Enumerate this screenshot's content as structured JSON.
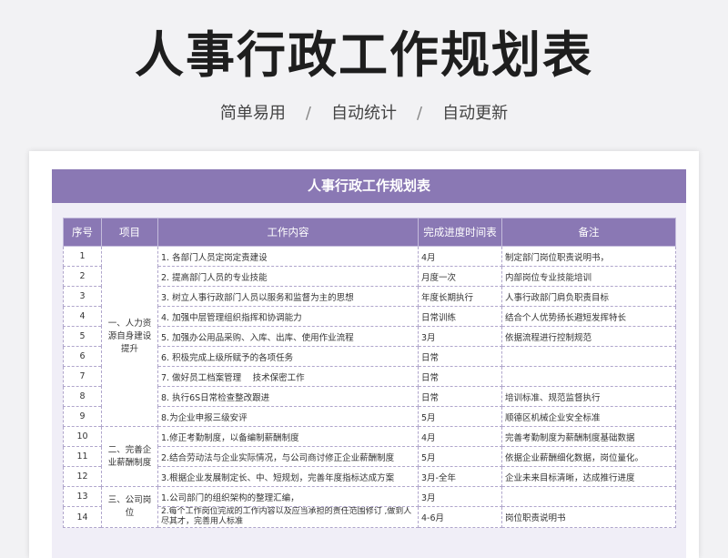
{
  "page": {
    "title": "人事行政工作规划表",
    "subtitle": [
      "简单易用",
      "自动统计",
      "自动更新"
    ],
    "separator": "/"
  },
  "sheet": {
    "header_title": "人事行政工作规划表",
    "columns": [
      "序号",
      "项目",
      "工作内容",
      "完成进度时间表",
      "备注"
    ],
    "rows": [
      {
        "no": "1",
        "content": "1. 各部门人员定岗定责建设",
        "time": "4月",
        "note": "制定部门岗位职责说明书，"
      },
      {
        "no": "2",
        "content": "2. 提高部门人员的专业技能",
        "time": "月度一次",
        "note": "内部岗位专业技能培训"
      },
      {
        "no": "3",
        "content": "3. 树立人事行政部门人员以服务和监督为主的思想",
        "time": "年度长期执行",
        "note": "人事行政部门肩负职责目标"
      },
      {
        "no": "4",
        "content": "4. 加强中层管理组织指挥和协调能力",
        "time": "日常训练",
        "note": "结合个人优势扬长避短发挥特长"
      },
      {
        "no": "5",
        "content": "5. 加强办公用品采购、入库、出库、使用作业流程",
        "time": "3月",
        "note": "依据流程进行控制规范"
      },
      {
        "no": "6",
        "content": "6. 积极完成上级所赋予的各项任务",
        "time": "日常",
        "note": ""
      },
      {
        "no": "7",
        "content": "7. 做好员工档案管理　 技术保密工作",
        "time": "日常",
        "note": ""
      },
      {
        "no": "8",
        "content": "8. 执行6S日常检查整改跟进",
        "time": "日常",
        "note": "培训标准、规范监督执行"
      },
      {
        "no": "9",
        "content": "8.为企业申报三级安评",
        "time": "5月",
        "note": "顺德区机械企业安全标准"
      },
      {
        "no": "10",
        "content": "1.修正考勤制度，以备编制薪酬制度",
        "time": "4月",
        "note": "完善考勤制度为薪酬制度基础数据"
      },
      {
        "no": "11",
        "content": "2.结合劳动法与企业实际情况，与公司商讨修正企业薪酬制度",
        "time": "5月",
        "note": "依据企业薪酬细化数据，岗位量化。"
      },
      {
        "no": "12",
        "content": "3.根据企业发展制定长、中、短规划，完善年度指标达成方案",
        "time": "3月-全年",
        "note": "企业未来目标清晰，达成推行进度"
      },
      {
        "no": "13",
        "content": "1.公司部门的组织架构的整理汇编，",
        "time": "3月",
        "note": ""
      },
      {
        "no": "14",
        "content": "2.每个工作岗位完成的工作内容以及应当承担的责任范围修订 ,做到人尽其才，完善用人标准",
        "time": "4-6月",
        "note": "岗位职责说明书"
      }
    ],
    "groups": [
      "一、人力资源自身建设提升",
      "二、完善企业薪酬制度",
      "三、公司岗位"
    ]
  }
}
